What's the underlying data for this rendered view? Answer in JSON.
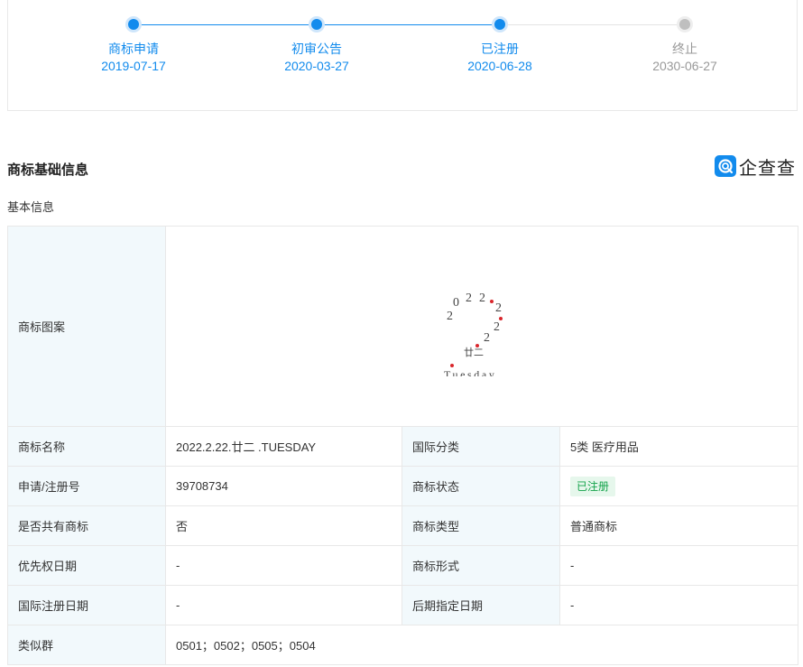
{
  "timeline": {
    "steps": [
      {
        "label": "商标申请",
        "date": "2019-07-17",
        "state": "done"
      },
      {
        "label": "初审公告",
        "date": "2020-03-27",
        "state": "done"
      },
      {
        "label": "已注册",
        "date": "2020-06-28",
        "state": "done"
      },
      {
        "label": "终止",
        "date": "2030-06-27",
        "state": "todo"
      }
    ],
    "active_color": "#128bed",
    "inactive_color": "#bfbfbf"
  },
  "section": {
    "title": "商标基础信息",
    "subtitle": "基本信息"
  },
  "brand": {
    "name": "企查查",
    "icon": "qcc-logo-icon",
    "color": "#128bed"
  },
  "trademark": {
    "image_label": "商标图案",
    "logo_text": {
      "digits": [
        "2",
        "0",
        "2",
        "2",
        "2",
        "2",
        "2",
        "2"
      ],
      "chinese": "廿二",
      "word": "Tuesday"
    },
    "rows": [
      {
        "l1": "商标名称",
        "v1": "2022.2.22.廿二 .TUESDAY",
        "l2": "国际分类",
        "v2": "5类 医疗用品"
      },
      {
        "l1": "申请/注册号",
        "v1": "39708734",
        "l2": "商标状态",
        "v2": "已注册"
      },
      {
        "l1": "是否共有商标",
        "v1": "否",
        "l2": "商标类型",
        "v2": "普通商标"
      },
      {
        "l1": "优先权日期",
        "v1": "-",
        "l2": "商标形式",
        "v2": "-"
      },
      {
        "l1": "国际注册日期",
        "v1": "-",
        "l2": "后期指定日期",
        "v2": "-"
      }
    ],
    "similar_group_label": "类似群",
    "similar_group_value": "0501；0502；0505；0504",
    "status_color": "#13a34a"
  }
}
